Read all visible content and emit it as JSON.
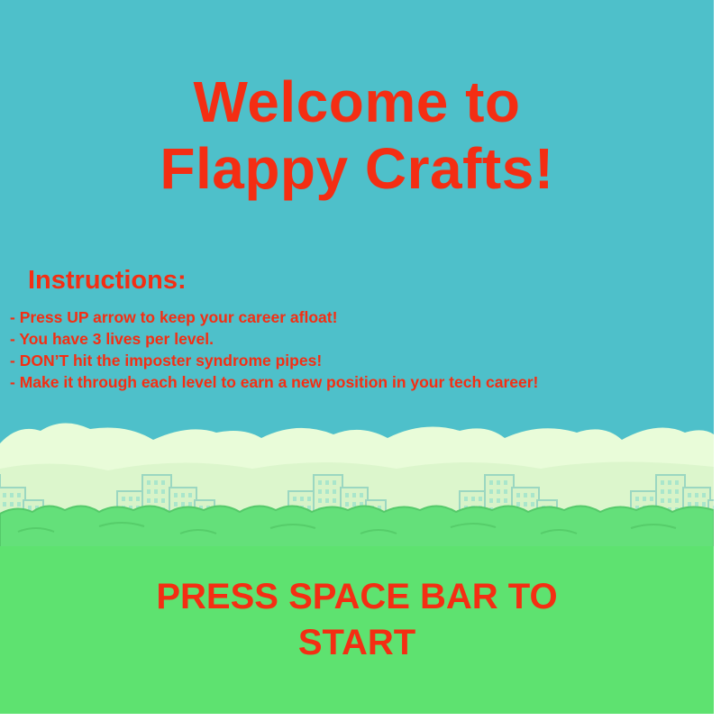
{
  "colors": {
    "sky": "#4ec0ca",
    "cloud": "#e9fcd9",
    "cloud_shade": "#d4f0c4",
    "building": "#d7f3c8",
    "building_window": "#a9e6cb",
    "building_outline": "#9bd7c1",
    "bush": "#64e07a",
    "bush_outline": "#52c466",
    "ground": "#5ee270",
    "text": "#f42e13"
  },
  "title": {
    "line1": "Welcome to",
    "line2": "Flappy Crafts!"
  },
  "instructions": {
    "heading": "Instructions:",
    "items": [
      "- Press UP arrow to keep your career afloat!",
      "- You have 3 lives per level.",
      "- DON’T hit the imposter syndrome pipes!",
      "- Make it through each level to earn a new position in your tech career!"
    ]
  },
  "start_prompt": {
    "line1": "PRESS SPACE BAR TO",
    "line2": "START"
  },
  "icons": {
    "background": "city-skyline-scene"
  }
}
